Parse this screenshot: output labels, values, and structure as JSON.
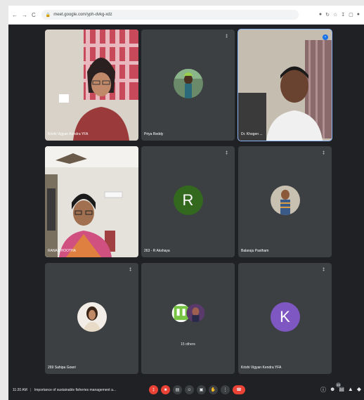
{
  "browser": {
    "url": "meet.google.com/yph-dvkg-xdz",
    "nav_back": "←",
    "nav_forward": "→",
    "nav_reload": "C"
  },
  "tiles": [
    {
      "name": "Krishi Vigyan Kendra YFA"
    },
    {
      "name": "Priya Reddy"
    },
    {
      "name": "Dr. Khogen ..."
    },
    {
      "name": "RANA DHOOTHA"
    },
    {
      "name": "263 - R Akshaya",
      "letter": "R",
      "color": "#33691e"
    },
    {
      "name": "Balaraju Pastham"
    },
    {
      "name": "269 Sahipa Gowri"
    },
    {
      "name": "15 others"
    },
    {
      "name": "Krishi Vigyan Kendra YFA",
      "letter": "K",
      "color": "#7e57c2"
    }
  ],
  "bottom": {
    "time": "11:20 AM",
    "separator": "|",
    "meeting_title": "Importance of sustainable fisheries management a...",
    "badge_count": "19"
  }
}
